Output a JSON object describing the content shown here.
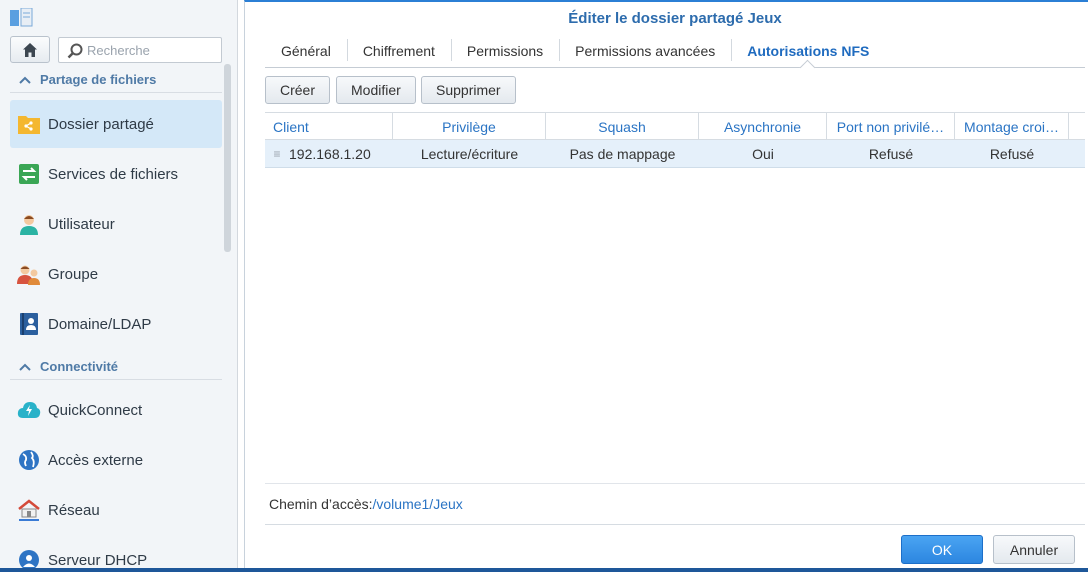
{
  "sidebar": {
    "search_placeholder": "Recherche",
    "sections": [
      {
        "label": "Partage de fichiers"
      },
      {
        "label": "Connectivité"
      }
    ],
    "items": [
      {
        "label": "Dossier partagé",
        "icon": "shared-folder-icon"
      },
      {
        "label": "Services de fichiers",
        "icon": "file-services-icon"
      },
      {
        "label": "Utilisateur",
        "icon": "user-icon"
      },
      {
        "label": "Groupe",
        "icon": "group-icon"
      },
      {
        "label": "Domaine/LDAP",
        "icon": "domain-ldap-icon"
      },
      {
        "label": "QuickConnect",
        "icon": "quickconnect-icon"
      },
      {
        "label": "Accès externe",
        "icon": "globe-icon"
      },
      {
        "label": "Réseau",
        "icon": "network-icon"
      },
      {
        "label": "Serveur DHCP",
        "icon": "dhcp-icon"
      }
    ]
  },
  "dialog": {
    "title": "Éditer le dossier partagé Jeux",
    "tabs": [
      {
        "label": "Général"
      },
      {
        "label": "Chiffrement"
      },
      {
        "label": "Permissions"
      },
      {
        "label": "Permissions avancées"
      },
      {
        "label": "Autorisations NFS"
      }
    ],
    "buttons": {
      "create": "Créer",
      "edit": "Modifier",
      "delete": "Supprimer"
    },
    "columns": [
      "Client",
      "Privilège",
      "Squash",
      "Asynchronie",
      "Port non privilé…",
      "Montage croi…"
    ],
    "rows": [
      {
        "client": "192.168.1.20",
        "privilege": "Lecture/écriture",
        "squash": "Pas de mappage",
        "async": "Oui",
        "port": "Refusé",
        "crossmnt": "Refusé"
      }
    ],
    "path_label": "Chemin d’accès:",
    "path_value": "/volume1/Jeux",
    "ok": "OK",
    "cancel": "Annuler"
  },
  "colors": {
    "accent": "#2b7fd5",
    "active_nav": "#d4e8f8",
    "section": "#4f7aa6"
  }
}
